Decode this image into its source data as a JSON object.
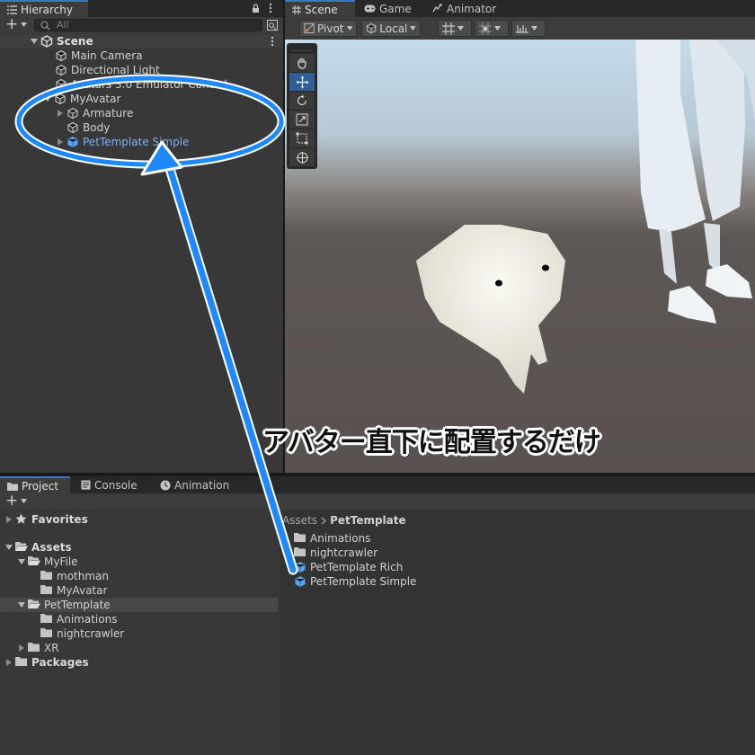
{
  "hierarchy": {
    "tab_label": "Hierarchy",
    "add_label": "+",
    "search_placeholder": "All",
    "scene_name": "Scene",
    "items": [
      {
        "label": "Main Camera"
      },
      {
        "label": "Directional Light"
      },
      {
        "label": "Avatars 3.0 Emulator Control"
      },
      {
        "label": "MyAvatar"
      },
      {
        "label": "Armature"
      },
      {
        "label": "Body"
      },
      {
        "label": "PetTemplate Simple"
      }
    ]
  },
  "scene_view": {
    "tabs": [
      {
        "label": "Scene"
      },
      {
        "label": "Game"
      },
      {
        "label": "Animator"
      }
    ],
    "pivot_label": "Pivot",
    "local_label": "Local",
    "tools": [
      "hand-tool",
      "move-tool",
      "rotate-tool",
      "scale-tool",
      "rect-tool",
      "transform-tool"
    ]
  },
  "project": {
    "tabs": [
      {
        "label": "Project"
      },
      {
        "label": "Console"
      },
      {
        "label": "Animation"
      }
    ],
    "add_label": "+",
    "tree": [
      {
        "label": "Favorites"
      },
      {
        "label": "Assets"
      },
      {
        "label": "MyFile"
      },
      {
        "label": "mothman"
      },
      {
        "label": "MyAvatar"
      },
      {
        "label": "PetTemplate"
      },
      {
        "label": "Animations"
      },
      {
        "label": "nightcrawler"
      },
      {
        "label": "XR"
      },
      {
        "label": "Packages"
      }
    ],
    "breadcrumb": {
      "root": "Assets",
      "current": "PetTemplate"
    },
    "files": [
      {
        "label": "Animations"
      },
      {
        "label": "nightcrawler"
      },
      {
        "label": "PetTemplate Rich"
      },
      {
        "label": "PetTemplate Simple"
      }
    ]
  },
  "annotation": {
    "caption": "アバター直下に配置するだけ",
    "color": "#1e88ff"
  },
  "colors": {
    "selection_blue": "#7fb1ef",
    "accent": "#3a79bb"
  }
}
